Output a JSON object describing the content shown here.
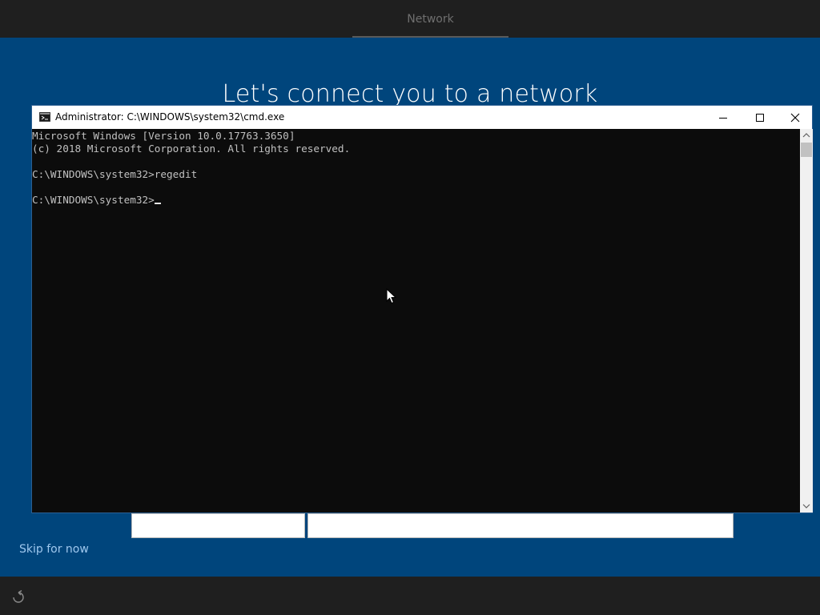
{
  "oobe": {
    "tab_label": "Network",
    "headline": "Let's connect you to a network",
    "skip_label": "Skip for now",
    "ease_of_access_icon": "ease-of-access-icon"
  },
  "cmd": {
    "title": "Administrator: C:\\WINDOWS\\system32\\cmd.exe",
    "app_icon": "console-icon",
    "lines": [
      "Microsoft Windows [Version 10.0.17763.3650]",
      "(c) 2018 Microsoft Corporation. All rights reserved.",
      "",
      "C:\\WINDOWS\\system32>regedit",
      "",
      "C:\\WINDOWS\\system32>"
    ],
    "buttons": {
      "minimize": "minimize-icon",
      "maximize": "maximize-icon",
      "close": "close-icon"
    }
  },
  "colors": {
    "desktop_blue": "#00457c",
    "bar_dark": "#1f1f1f",
    "console_bg": "#0c0c0c",
    "console_text": "#c0c0c0",
    "link": "#9fc8ee"
  }
}
